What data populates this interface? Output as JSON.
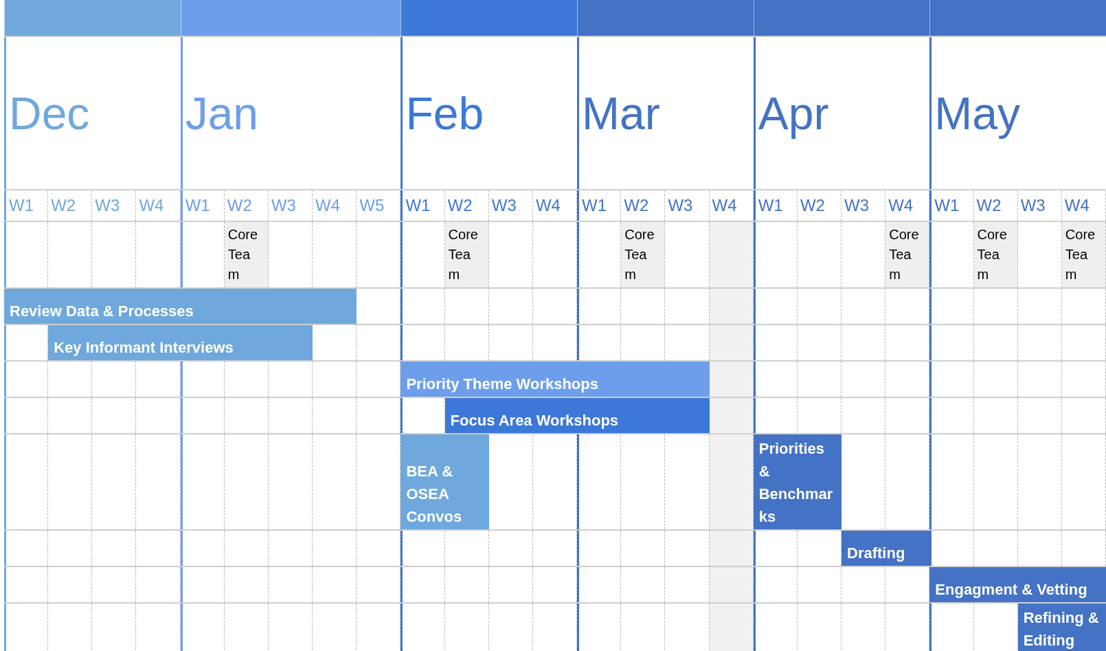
{
  "months": [
    {
      "name": "Dec",
      "color": "#6fa8dc",
      "weeks": [
        {
          "label": "W1",
          "shaded": false
        },
        {
          "label": "W2",
          "shaded": false
        },
        {
          "label": "W3",
          "shaded": false
        },
        {
          "label": "W4",
          "shaded": false
        }
      ]
    },
    {
      "name": "Jan",
      "color": "#6d9eeb",
      "weeks": [
        {
          "label": "W1",
          "shaded": false
        },
        {
          "label": "W2",
          "shaded": false,
          "core_team": "Core Team"
        },
        {
          "label": "W3",
          "shaded": false
        },
        {
          "label": "W4",
          "shaded": false
        },
        {
          "label": "W5",
          "shaded": false
        }
      ]
    },
    {
      "name": "Feb",
      "color": "#3c78d8",
      "weeks": [
        {
          "label": "W1",
          "shaded": false
        },
        {
          "label": "W2",
          "shaded": false,
          "core_team": "Core Team"
        },
        {
          "label": "W3",
          "shaded": false
        },
        {
          "label": "W4",
          "shaded": false
        }
      ]
    },
    {
      "name": "Mar",
      "color": "#4472c4",
      "weeks": [
        {
          "label": "W1",
          "shaded": false
        },
        {
          "label": "W2",
          "shaded": false,
          "core_team": "Core Team"
        },
        {
          "label": "W3",
          "shaded": false
        },
        {
          "label": "W4",
          "shaded": true
        }
      ]
    },
    {
      "name": "Apr",
      "color": "#4472c4",
      "weeks": [
        {
          "label": "W1",
          "shaded": false
        },
        {
          "label": "W2",
          "shaded": false
        },
        {
          "label": "W3",
          "shaded": false
        },
        {
          "label": "W4",
          "shaded": false,
          "core_team": "Core Team"
        }
      ]
    },
    {
      "name": "May",
      "color": "#4472c4",
      "weeks": [
        {
          "label": "W1",
          "shaded": false
        },
        {
          "label": "W2",
          "shaded": false,
          "core_team": "Core Team"
        },
        {
          "label": "W3",
          "shaded": false
        },
        {
          "label": "W4",
          "shaded": false,
          "core_team": "Core Team"
        }
      ]
    }
  ],
  "rows": [
    {
      "bars": [
        {
          "label": "Review Data & Processes",
          "color": "#6fa8dc"
        }
      ]
    },
    {
      "bars": [
        {
          "label": "Key Informant Interviews",
          "color": "#6fa8dc"
        }
      ]
    },
    {
      "bars": [
        {
          "label": "Priority Theme Workshops",
          "color": "#6d9eeb"
        }
      ]
    },
    {
      "bars": [
        {
          "label": "Focus Area Workshops",
          "color": "#3c78d8"
        }
      ]
    },
    {
      "bars": [
        {
          "label": "BEA & OSEA Convos",
          "color": "#6fa8dc"
        },
        {
          "label": "Priorities & Benchmarks",
          "color": "#4472c4"
        }
      ]
    },
    {
      "bars": [
        {
          "label": "Drafting",
          "color": "#4472c4"
        }
      ]
    },
    {
      "bars": [
        {
          "label": "Engagment & Vetting",
          "color": "#4472c4"
        }
      ]
    },
    {
      "bars": [
        {
          "label": "Refining & Editing",
          "color": "#4472c4"
        }
      ]
    }
  ]
}
